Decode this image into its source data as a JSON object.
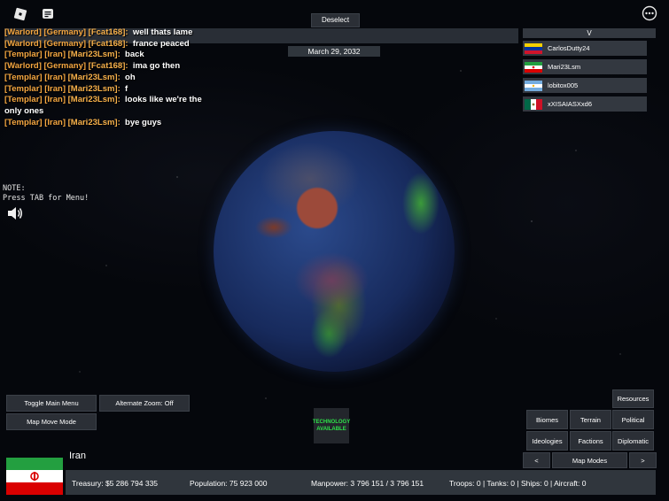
{
  "topbar": {
    "deselect_label": "Deselect",
    "date": "March 29, 2032",
    "players_header": "V"
  },
  "chat": [
    {
      "tag": "[Warlord]",
      "faction": "[Germany]",
      "speaker": "[Fcat168]:",
      "message": "well thats lame",
      "tag_color": "#f4a640"
    },
    {
      "tag": "[Warlord]",
      "faction": "[Germany]",
      "speaker": "[Fcat168]:",
      "message": "france peaced",
      "tag_color": "#f4a640"
    },
    {
      "tag": "[Templar]",
      "faction": "[Iran]",
      "speaker": "[Mari23Lsm]:",
      "message": "back",
      "tag_color": "#f4a640"
    },
    {
      "tag": "[Warlord]",
      "faction": "[Germany]",
      "speaker": "[Fcat168]:",
      "message": "ima go then",
      "tag_color": "#f4a640"
    },
    {
      "tag": "[Templar]",
      "faction": "[Iran]",
      "speaker": "[Mari23Lsm]:",
      "message": "oh",
      "tag_color": "#f4a640"
    },
    {
      "tag": "[Templar]",
      "faction": "[Iran]",
      "speaker": "[Mari23Lsm]:",
      "message": "f",
      "tag_color": "#f4a640"
    },
    {
      "tag": "[Templar]",
      "faction": "[Iran]",
      "speaker": "[Mari23Lsm]:",
      "message": "looks like we're the only ones",
      "tag_color": "#f4a640"
    },
    {
      "tag": "[Templar]",
      "faction": "[Iran]",
      "speaker": "[Mari23Lsm]:",
      "message": "bye guys",
      "tag_color": "#f4a640"
    }
  ],
  "note": {
    "line1": "NOTE:",
    "line2": "Press TAB for Menu!"
  },
  "players": [
    {
      "name": "CarlosDutty24",
      "flag": "venezuela"
    },
    {
      "name": "Mari23Lsm",
      "flag": "iran"
    },
    {
      "name": "lobitox005",
      "flag": "argentina"
    },
    {
      "name": "xXISAIASXxd6",
      "flag": "mexico"
    }
  ],
  "buttons": {
    "toggle_main_menu": "Toggle Main Menu",
    "alternate_zoom": "Alternate Zoom: Off",
    "map_move_mode": "Map Move Mode",
    "technology": "TECHNOLOGY AVAILABLE",
    "resources": "Resources",
    "biomes": "Biomes",
    "terrain": "Terrain",
    "political": "Political",
    "ideologies": "Ideologies",
    "factions": "Factions",
    "diplomatic": "Diplomatic",
    "prev": "<",
    "map_modes": "Map Modes",
    "next": ">"
  },
  "nation": {
    "name": "Iran",
    "treasury": "Treasury:  $5 286 794 335",
    "population": "Population: 75 923 000",
    "manpower": "Manpower:  3 796 151  /  3 796 151",
    "forces": "Troops: 0  |  Tanks: 0  |  Ships: 0  |  Aircraft: 0"
  },
  "colors": {
    "panel": "#383e46",
    "tech_text": "#2ee34a",
    "chat_tag": "#f4a640"
  }
}
